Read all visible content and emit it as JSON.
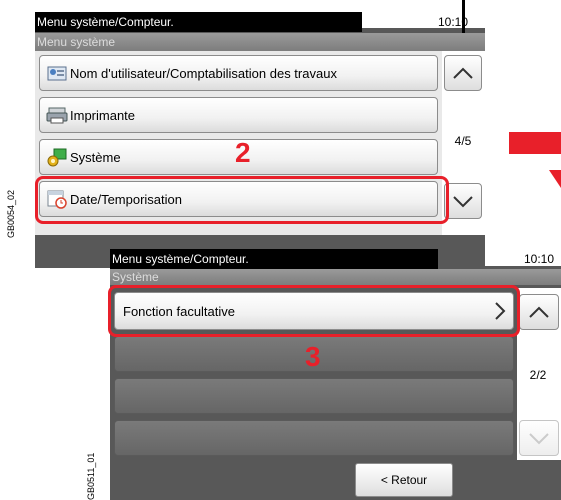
{
  "panel1": {
    "title": "Menu système/Compteur.",
    "clock": "10:10",
    "subheader": "Menu système",
    "items": [
      {
        "label": "Nom d'utilisateur/Comptabilisation des travaux",
        "icon": "user-accounting-icon"
      },
      {
        "label": "Imprimante",
        "icon": "printer-icon"
      },
      {
        "label": "Système",
        "icon": "system-icon"
      },
      {
        "label": "Date/Temporisation",
        "icon": "date-timer-icon"
      }
    ],
    "page": "4/5",
    "step": "2",
    "code": "GB0054_02"
  },
  "panel2": {
    "title": "Menu système/Compteur.",
    "clock": "10:10",
    "subheader": "Système",
    "items": [
      {
        "label": "Fonction facultative"
      }
    ],
    "page": "2/2",
    "step": "3",
    "back_label": "< Retour",
    "code": "GB0511_01"
  },
  "colors": {
    "highlight": "#e8202a",
    "panel_background": "#585858",
    "titlebar": "#000000"
  }
}
